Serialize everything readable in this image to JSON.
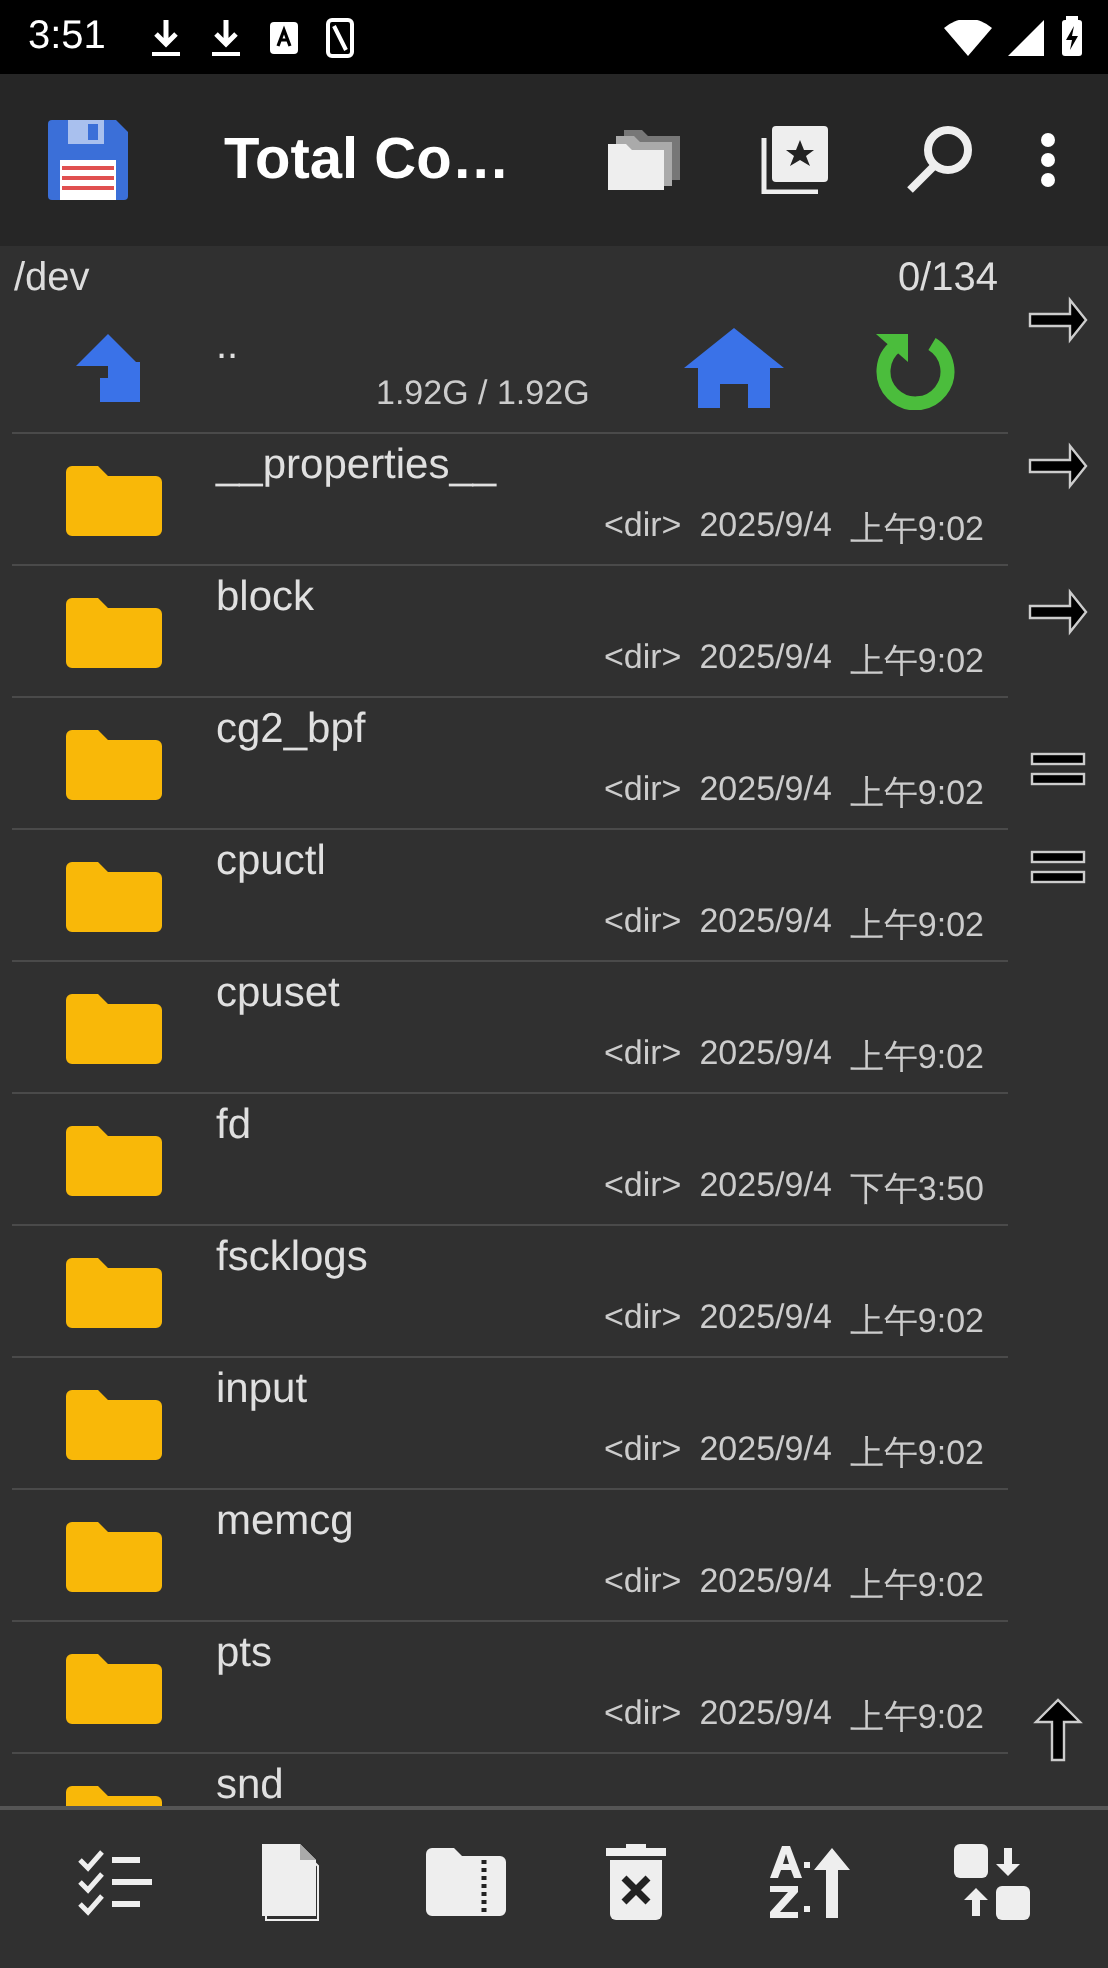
{
  "status_bar": {
    "time": "3:51"
  },
  "app_bar": {
    "title": "Total Co…"
  },
  "panel": {
    "path": "/dev",
    "count": "0/134",
    "parent": {
      "name": "..",
      "space": "1.92G / 1.92G"
    },
    "files": [
      {
        "name": "__properties__",
        "size": "<dir>",
        "date": "2025/9/4",
        "time": "上午9:02"
      },
      {
        "name": "block",
        "size": "<dir>",
        "date": "2025/9/4",
        "time": "上午9:02"
      },
      {
        "name": "cg2_bpf",
        "size": "<dir>",
        "date": "2025/9/4",
        "time": "上午9:02"
      },
      {
        "name": "cpuctl",
        "size": "<dir>",
        "date": "2025/9/4",
        "time": "上午9:02"
      },
      {
        "name": "cpuset",
        "size": "<dir>",
        "date": "2025/9/4",
        "time": "上午9:02"
      },
      {
        "name": "fd",
        "size": "<dir>",
        "date": "2025/9/4",
        "time": "下午3:50"
      },
      {
        "name": "fscklogs",
        "size": "<dir>",
        "date": "2025/9/4",
        "time": "上午9:02"
      },
      {
        "name": "input",
        "size": "<dir>",
        "date": "2025/9/4",
        "time": "上午9:02"
      },
      {
        "name": "memcg",
        "size": "<dir>",
        "date": "2025/9/4",
        "time": "上午9:02"
      },
      {
        "name": "pts",
        "size": "<dir>",
        "date": "2025/9/4",
        "time": "上午9:02"
      },
      {
        "name": "snd"
      }
    ]
  }
}
